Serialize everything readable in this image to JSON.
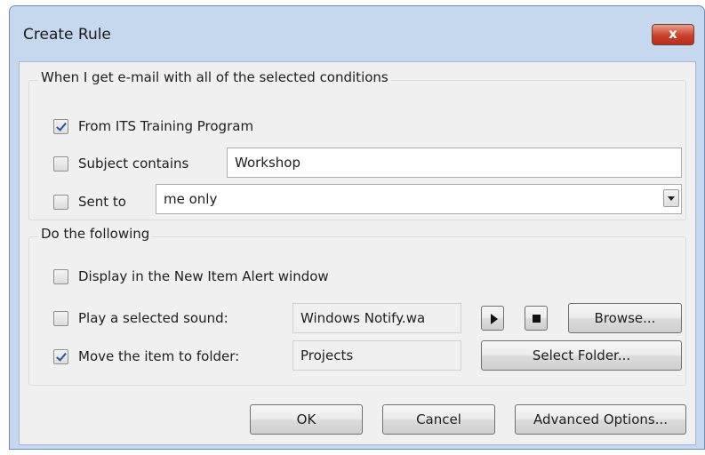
{
  "dialog": {
    "title": "Create Rule",
    "close_glyph": "x"
  },
  "conditions": {
    "legend": "When I get e-mail with all of the selected conditions",
    "from": {
      "label": "From ITS Training Program",
      "checked": true
    },
    "subject": {
      "label": "Subject contains",
      "value": "Workshop",
      "checked": false
    },
    "sent_to": {
      "label": "Sent to",
      "value": "me only",
      "checked": false
    }
  },
  "actions": {
    "legend": "Do the following",
    "alert": {
      "label": "Display in the New Item Alert window",
      "checked": false
    },
    "sound": {
      "label": "Play a selected sound:",
      "value": "Windows Notify.wa",
      "checked": false,
      "browse_label": "Browse..."
    },
    "move": {
      "label": "Move the item to folder:",
      "value": "Projects",
      "checked": true,
      "select_label": "Select Folder..."
    }
  },
  "footer": {
    "ok_label": "OK",
    "cancel_label": "Cancel",
    "advanced_label": "Advanced Options..."
  },
  "icons": [
    "close-icon",
    "checkmark-icon",
    "dropdown-arrow-icon",
    "play-icon",
    "stop-icon"
  ],
  "colors": {
    "titlebar": "#c6d8ee",
    "close_button": "#c9402a",
    "check": "#2b50a8",
    "client": "#f0f0f0"
  }
}
